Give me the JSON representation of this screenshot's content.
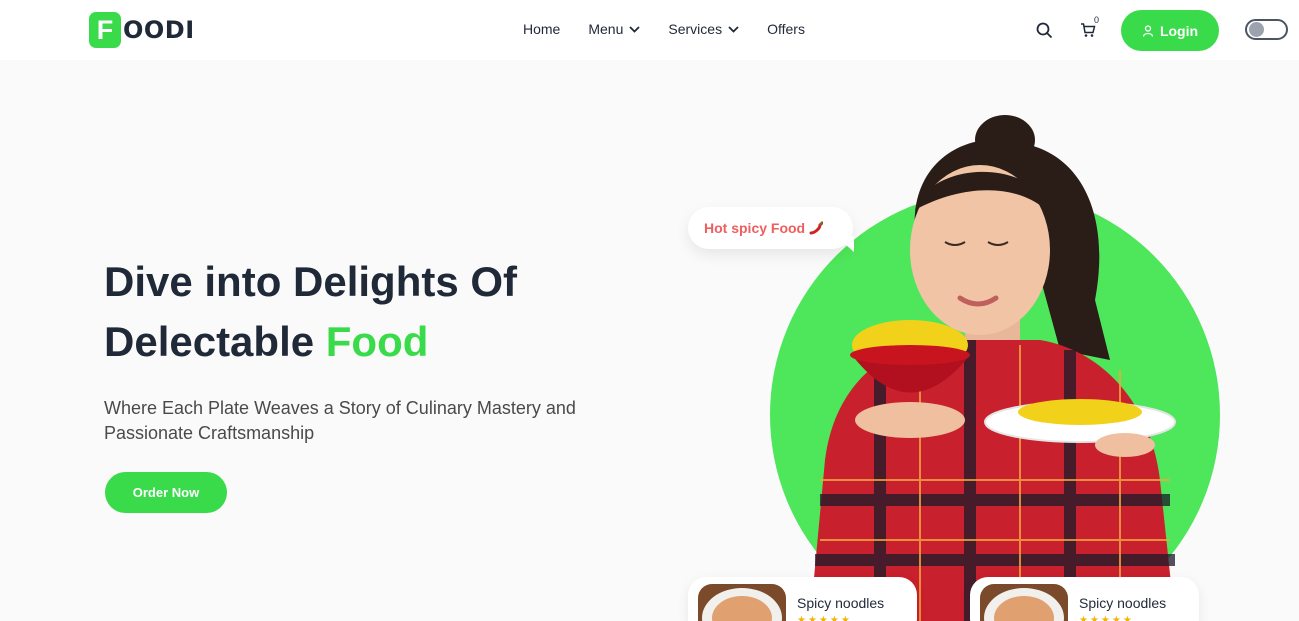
{
  "brand": {
    "logo_letter": "F",
    "logo_rest": "OODI",
    "accent_color": "#39db4a"
  },
  "nav": {
    "items": [
      {
        "label": "Home",
        "has_dropdown": false
      },
      {
        "label": "Menu",
        "has_dropdown": true
      },
      {
        "label": "Services",
        "has_dropdown": true
      },
      {
        "label": "Offers",
        "has_dropdown": false
      }
    ],
    "cart_count": "0",
    "login_label": "Login",
    "icons": [
      "search-icon",
      "cart-icon",
      "user-icon",
      "theme-toggle"
    ]
  },
  "hero": {
    "title_line1": "Dive into Delights Of",
    "title_line2_plain": "Delectable ",
    "title_line2_accent": "Food",
    "subtitle": "Where Each Plate Weaves a Story of Culinary Mastery and Passionate Craftsmanship",
    "cta_label": "Order Now",
    "bubble_text": "Hot spicy Food"
  },
  "cards": [
    {
      "name": "Spicy noodles",
      "stars": "★★★★★"
    },
    {
      "name": "Spicy noodles",
      "stars": "★★★★★"
    }
  ]
}
